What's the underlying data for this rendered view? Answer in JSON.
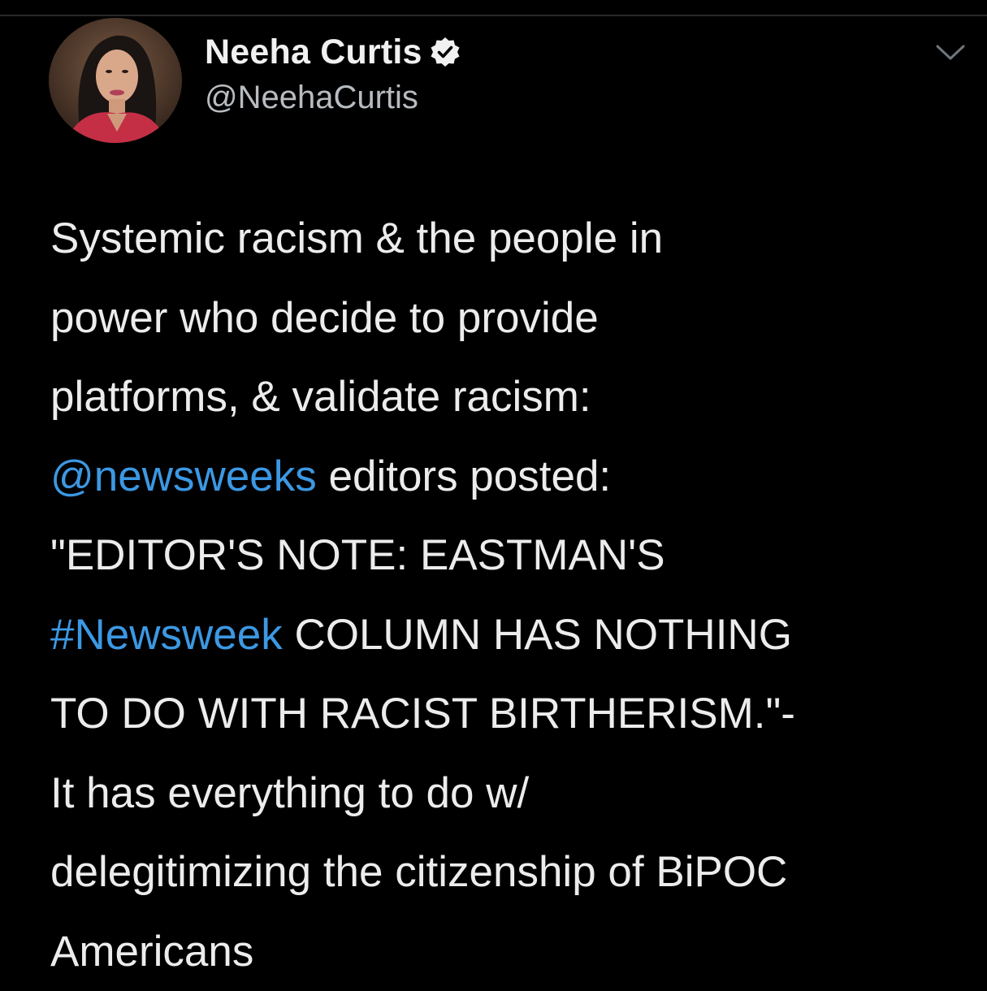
{
  "author": {
    "display_name": "Neeha Curtis",
    "handle": "@NeehaCurtis",
    "verified": true,
    "avatar_icon": "profile-photo"
  },
  "icons": {
    "verified": "verified-badge-icon",
    "more": "chevron-down-icon"
  },
  "colors": {
    "background": "#000000",
    "text": "#ececec",
    "link": "#3c98e3",
    "handle": "#b8bcc0"
  },
  "tweet": {
    "line1": "Systemic racism & the people in",
    "line2": "power who decide to provide",
    "line3": "platforms, & validate racism:",
    "line4_mention": "@newsweeks",
    "line4_rest": " editors posted:",
    "line5": "\"EDITOR'S NOTE: EASTMAN'S",
    "line6_hashtag": "#Newsweek",
    "line6_rest": " COLUMN HAS NOTHING",
    "line7": "TO DO WITH RACIST BIRTHERISM.\"-",
    "line8": "It has everything to do w/",
    "line9": "delegitimizing the citizenship of BiPOC",
    "line10": "Americans"
  }
}
